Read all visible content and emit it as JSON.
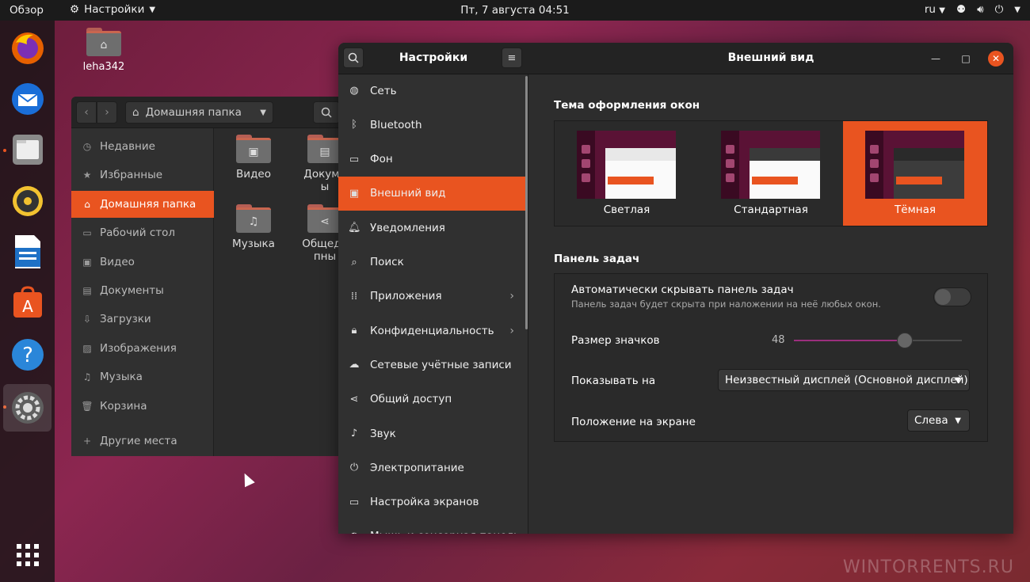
{
  "topbar": {
    "activities": "Обзор",
    "app_menu": "Настройки",
    "clock": "Пт, 7 августа  04:51",
    "lang": "ru"
  },
  "dock": {
    "items": [
      "firefox-icon",
      "thunderbird-icon",
      "files-icon",
      "rhythmbox-icon",
      "libreoffice-writer-icon",
      "software-center-icon",
      "help-icon",
      "settings-icon",
      "show-apps-icon"
    ]
  },
  "desktop": {
    "home_label": "leha342"
  },
  "files": {
    "path": "Домашняя папка",
    "sidebar": [
      {
        "label": "Недавние",
        "icon": "clock-icon"
      },
      {
        "label": "Избранные",
        "icon": "star-icon"
      },
      {
        "label": "Домашняя папка",
        "icon": "home-icon"
      },
      {
        "label": "Рабочий стол",
        "icon": "desktop-icon"
      },
      {
        "label": "Видео",
        "icon": "video-icon"
      },
      {
        "label": "Документы",
        "icon": "document-icon"
      },
      {
        "label": "Загрузки",
        "icon": "download-icon"
      },
      {
        "label": "Изображения",
        "icon": "image-icon"
      },
      {
        "label": "Музыка",
        "icon": "music-icon"
      },
      {
        "label": "Корзина",
        "icon": "trash-icon"
      },
      {
        "label": "Другие места",
        "icon": "plus-icon"
      }
    ],
    "folders": [
      {
        "label": "Видео"
      },
      {
        "label": "Докуме\nы"
      },
      {
        "label": "Музыка"
      },
      {
        "label": "Общедо\nпны"
      }
    ]
  },
  "settings": {
    "left_title": "Настройки",
    "main_title": "Внешний вид",
    "nav": [
      {
        "label": "Сеть",
        "icon": "network-icon"
      },
      {
        "label": "Bluetooth",
        "icon": "bluetooth-icon"
      },
      {
        "label": "Фон",
        "icon": "background-icon"
      },
      {
        "label": "Внешний вид",
        "icon": "appearance-icon"
      },
      {
        "label": "Уведомления",
        "icon": "bell-icon"
      },
      {
        "label": "Поиск",
        "icon": "search-icon"
      },
      {
        "label": "Приложения",
        "icon": "apps-icon"
      },
      {
        "label": "Конфиденциальность",
        "icon": "lock-icon"
      },
      {
        "label": "Сетевые учётные записи",
        "icon": "cloud-icon"
      },
      {
        "label": "Общий доступ",
        "icon": "share-icon"
      },
      {
        "label": "Звук",
        "icon": "music-note-icon"
      },
      {
        "label": "Электропитание",
        "icon": "power-icon"
      },
      {
        "label": "Настройка экранов",
        "icon": "display-icon"
      },
      {
        "label": "Мышь и сенсорная панель",
        "icon": "mouse-icon"
      }
    ],
    "theme_section": "Тема оформления окон",
    "themes": [
      {
        "label": "Светлая"
      },
      {
        "label": "Стандартная"
      },
      {
        "label": "Тёмная"
      }
    ],
    "selected_theme": "Тёмная",
    "dock_section": "Панель задач",
    "autohide": {
      "label": "Автоматически скрывать панель задач",
      "sub": "Панель задач будет скрыта при наложении на неё любых окон.",
      "enabled": false
    },
    "icon_size": {
      "label": "Размер значков",
      "value": "48",
      "fraction": 0.66
    },
    "show_on": {
      "label": "Показывать на",
      "value": "Неизвестный дисплей (Основной дисплей)"
    },
    "position": {
      "label": "Положение на экране",
      "value": "Слева"
    }
  },
  "watermark": "WINTORRENTS.RU",
  "colors": {
    "accent": "#e95420",
    "panel": "#2d2d2d"
  }
}
